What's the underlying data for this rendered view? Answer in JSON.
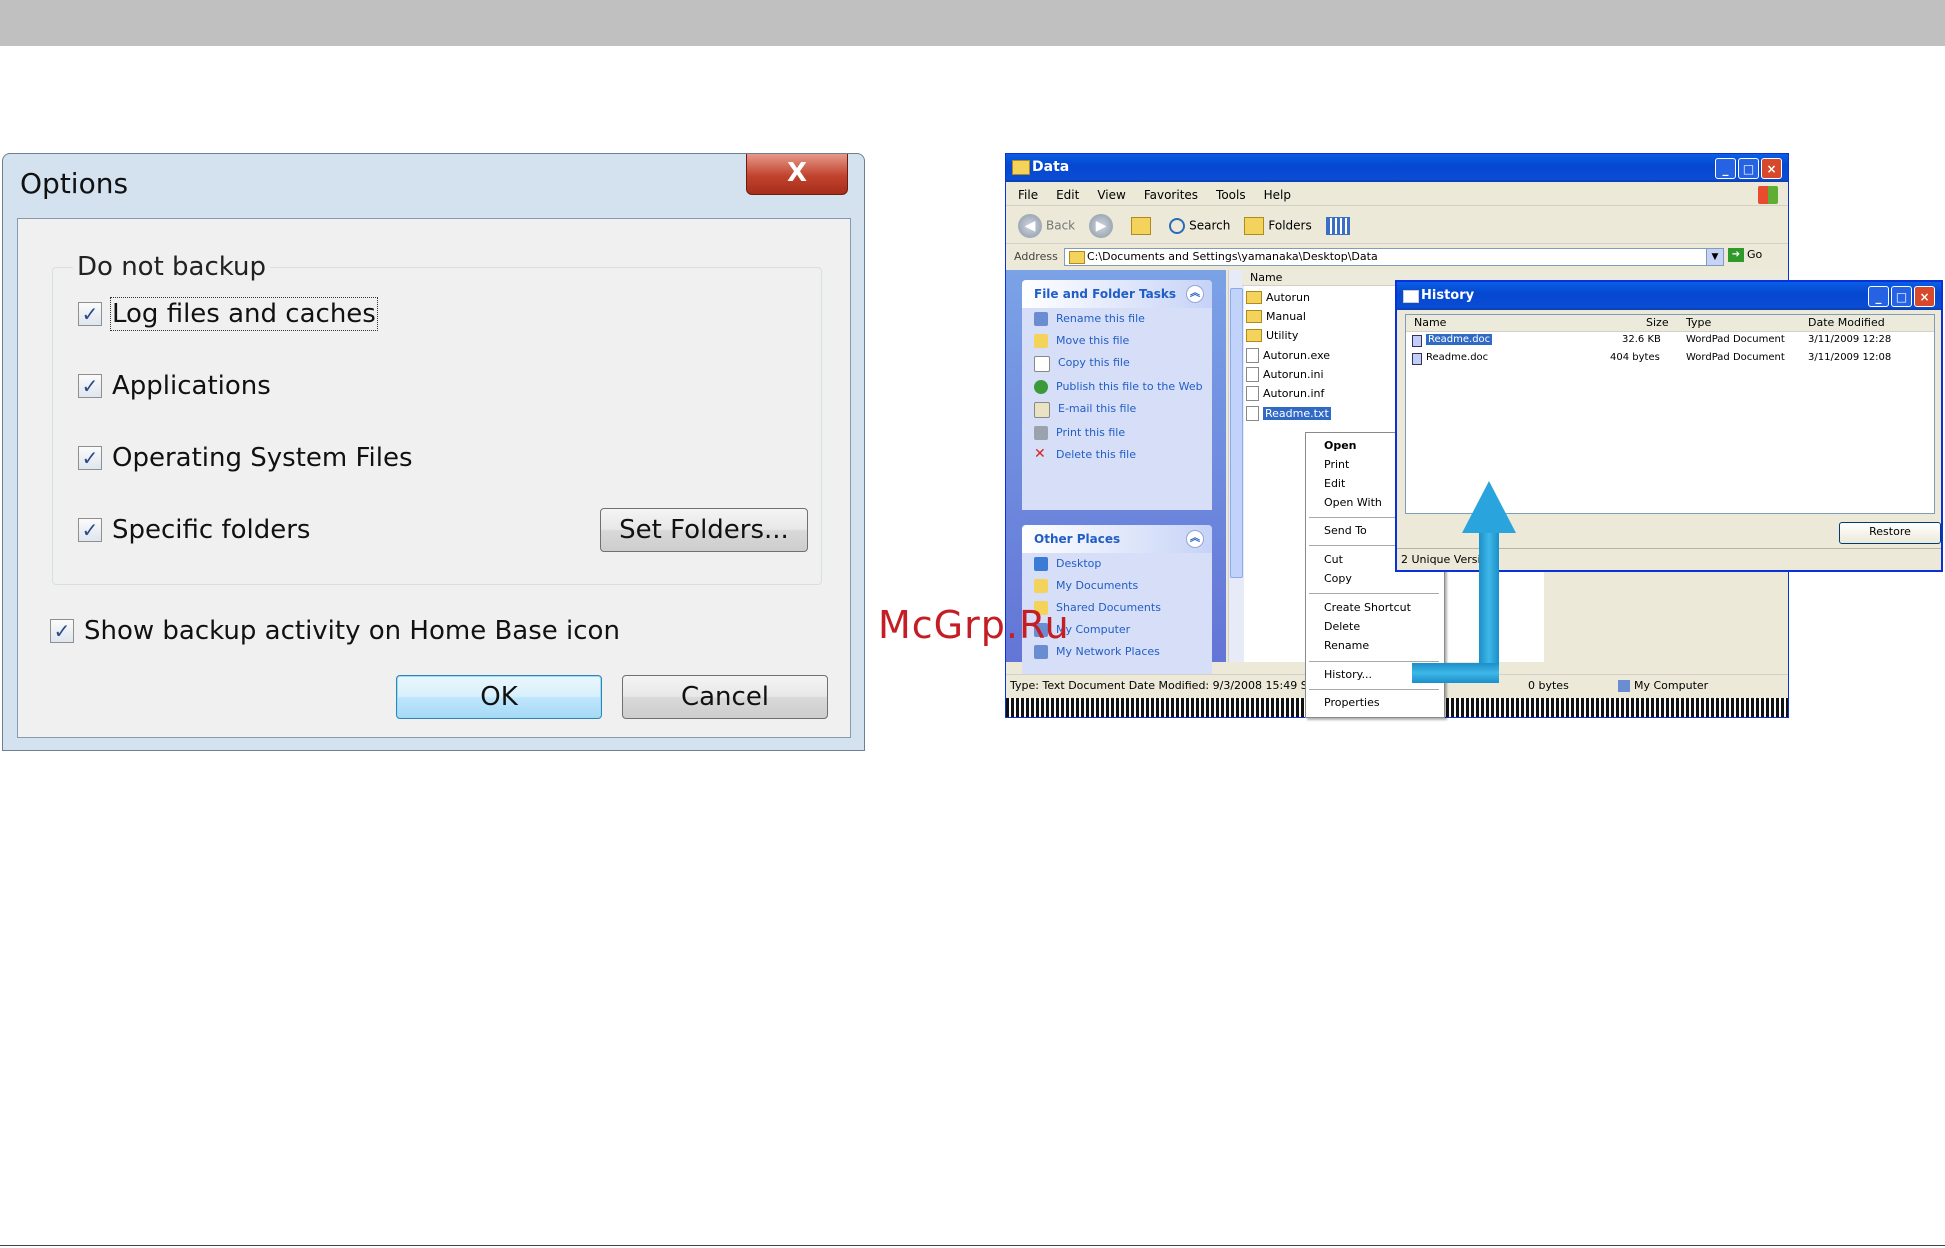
{
  "watermark": "McGrp.Ru",
  "options_dialog": {
    "title": "Options",
    "close_label": "X",
    "group_label": "Do not backup",
    "checkboxes": [
      {
        "label": "Log files and caches",
        "checked": true
      },
      {
        "label": "Applications",
        "checked": true
      },
      {
        "label": "Operating System Files",
        "checked": true
      },
      {
        "label": "Specific folders",
        "checked": true
      }
    ],
    "set_folders_label": "Set Folders...",
    "show_activity_label": "Show backup activity on Home Base icon",
    "show_activity_checked": true,
    "ok_label": "OK",
    "cancel_label": "Cancel",
    "check_glyph": "✓"
  },
  "explorer": {
    "title": "Data",
    "menu": [
      "File",
      "Edit",
      "View",
      "Favorites",
      "Tools",
      "Help"
    ],
    "toolbar": {
      "back": "Back",
      "search": "Search",
      "folders": "Folders"
    },
    "address_label": "Address",
    "address_value": "C:\\Documents and Settings\\yamanaka\\Desktop\\Data",
    "go_label": "Go",
    "tasks_panel": {
      "title": "File and Folder Tasks",
      "items": [
        "Rename this file",
        "Move this file",
        "Copy this file",
        "Publish this file to the Web",
        "E-mail this file",
        "Print this file",
        "Delete this file"
      ]
    },
    "places_panel": {
      "title": "Other Places",
      "items": [
        "Desktop",
        "My Documents",
        "Shared Documents",
        "My Computer",
        "My Network Places"
      ]
    },
    "column_name": "Name",
    "files": [
      {
        "name": "Autorun",
        "kind": "folder"
      },
      {
        "name": "Manual",
        "kind": "folder"
      },
      {
        "name": "Utility",
        "kind": "folder"
      },
      {
        "name": "Autorun.exe",
        "kind": "file"
      },
      {
        "name": "Autorun.ini",
        "kind": "file"
      },
      {
        "name": "Autorun.inf",
        "kind": "file"
      },
      {
        "name": "Readme.txt",
        "kind": "file",
        "selected": true
      }
    ],
    "status_left": "Type: Text Document Date Modified: 9/3/2008 15:49 S",
    "status_size": "0 bytes",
    "status_zone": "My Computer"
  },
  "context_menu": {
    "items": [
      "Open",
      "Print",
      "Edit",
      "Open With",
      "Send To",
      "Cut",
      "Copy",
      "Create Shortcut",
      "Delete",
      "Rename",
      "History...",
      "Properties"
    ]
  },
  "history": {
    "title": "History",
    "columns": [
      "Name",
      "Size",
      "Type",
      "Date Modified"
    ],
    "rows": [
      {
        "name": "Readme.doc",
        "size": "32.6 KB",
        "type": "WordPad Document",
        "date": "3/11/2009 12:28",
        "selected": true
      },
      {
        "name": "Readme.doc",
        "size": "404 bytes",
        "type": "WordPad Document",
        "date": "3/11/2009 12:08",
        "selected": false
      }
    ],
    "restore_label": "Restore",
    "status": "2 Unique Versio"
  }
}
